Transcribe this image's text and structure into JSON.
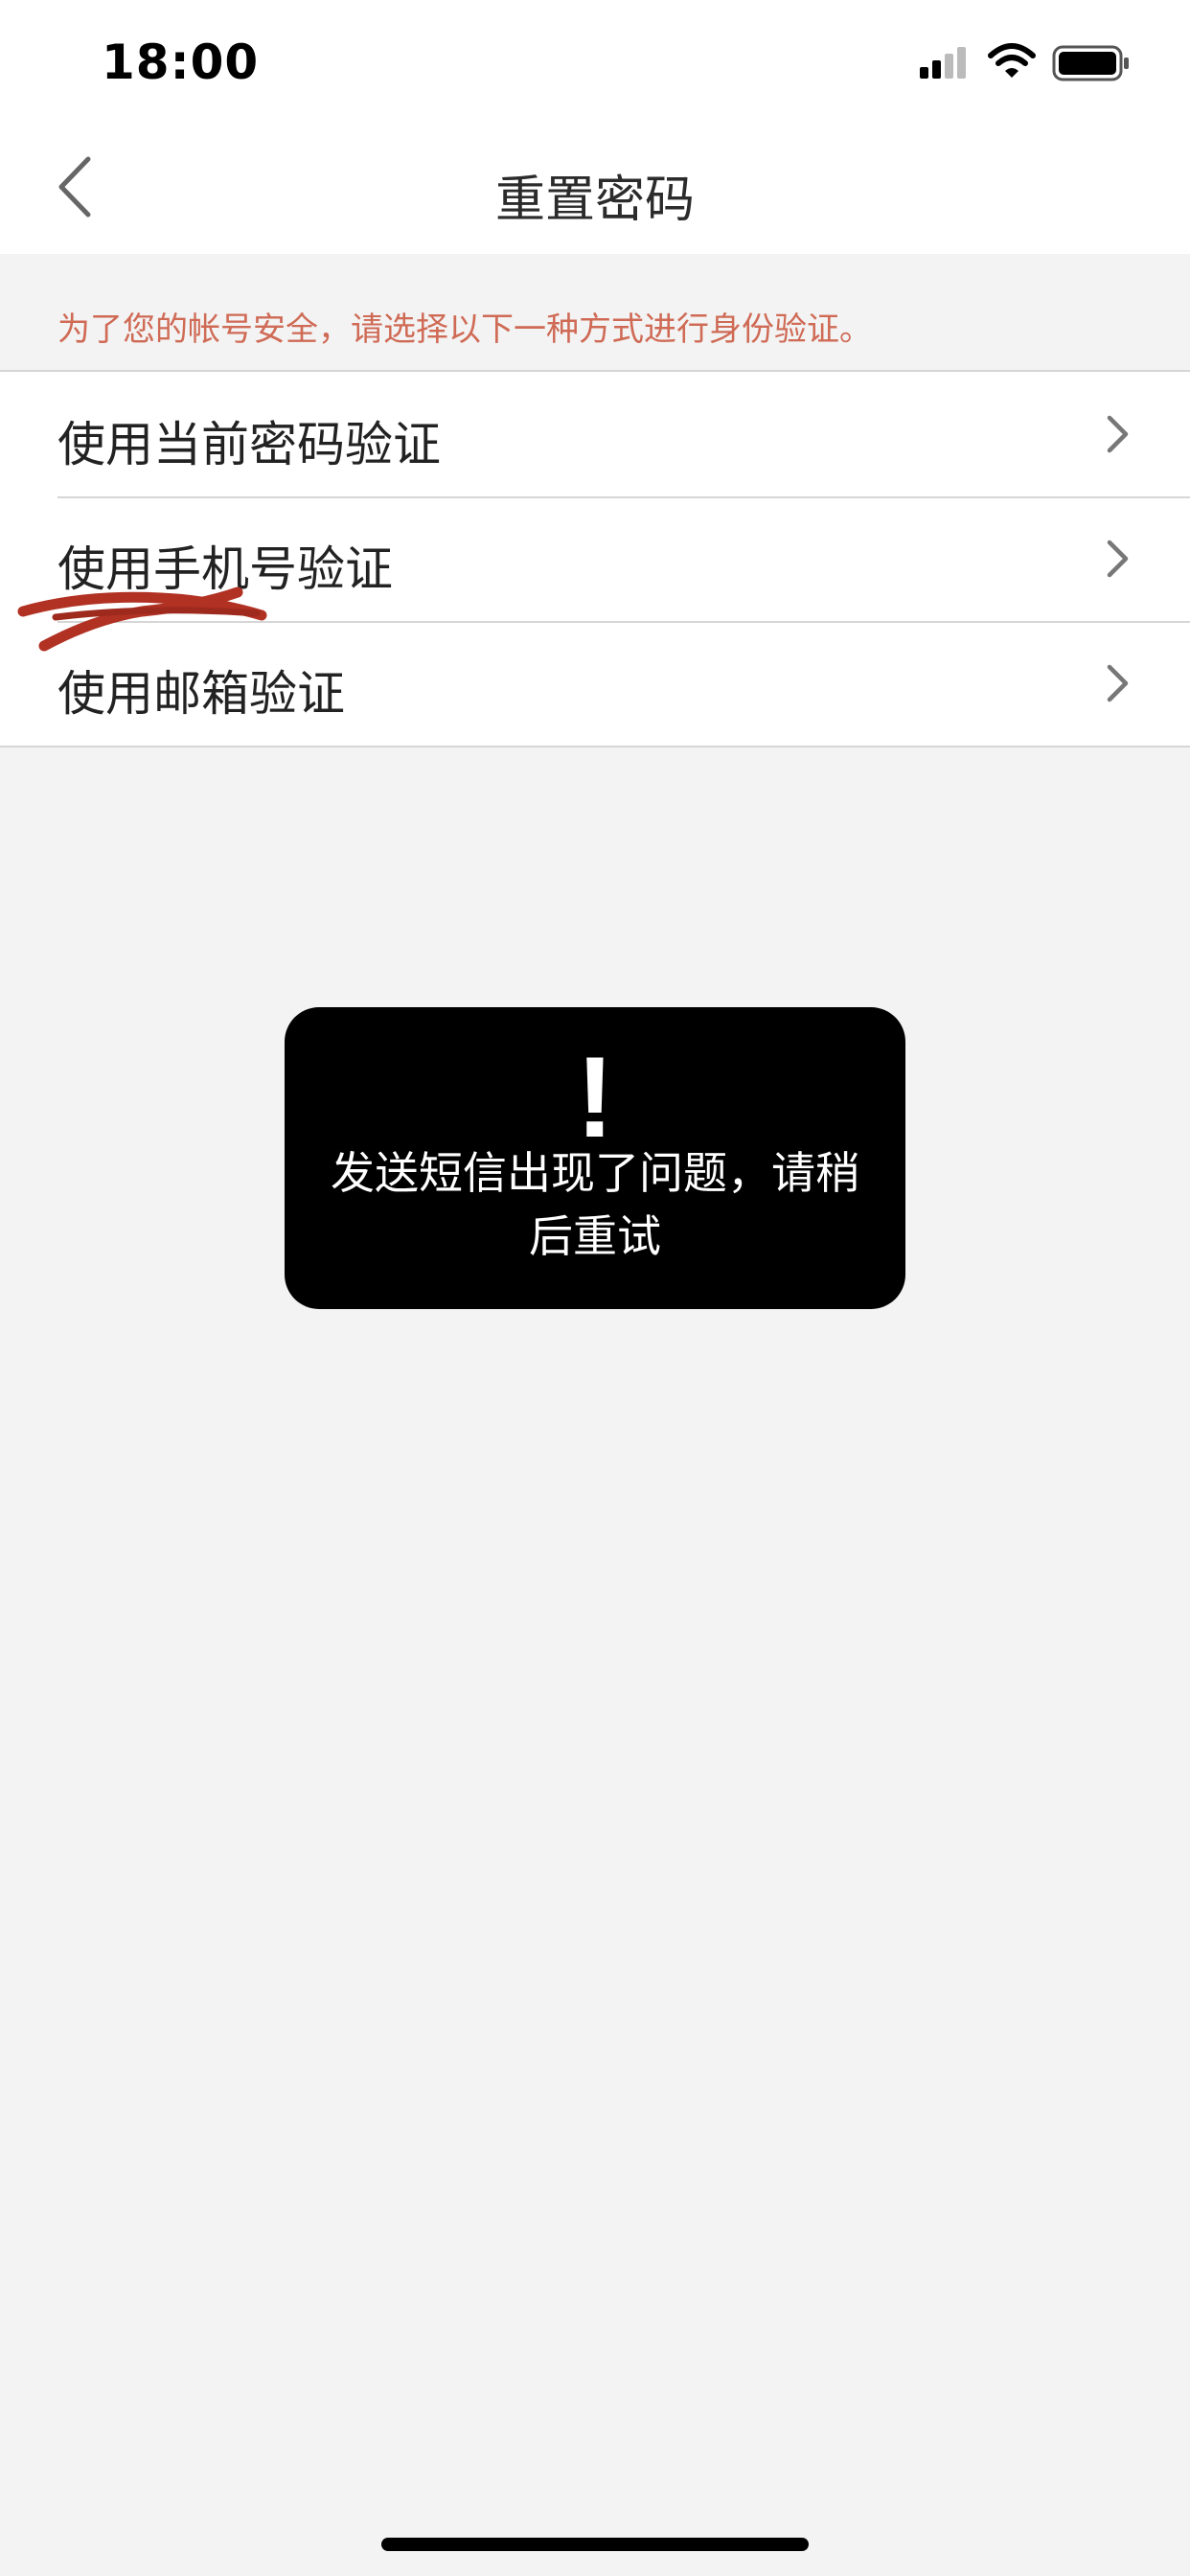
{
  "status_bar": {
    "time": "18:00",
    "icons": [
      "signal-icon",
      "wifi-icon",
      "battery-icon"
    ]
  },
  "nav": {
    "title": "重置密码",
    "back_icon": "chevron-left-icon"
  },
  "hint": "为了您的帐号安全，请选择以下一种方式进行身份验证。",
  "options": [
    {
      "label": "使用当前密码验证",
      "icon": "chevron-right-icon"
    },
    {
      "label": "使用手机号验证",
      "icon": "chevron-right-icon"
    },
    {
      "label": "使用邮箱验证",
      "icon": "chevron-right-icon"
    }
  ],
  "toast": {
    "icon": "!",
    "message": "发送短信出现了问题，请稍后重试"
  },
  "colors": {
    "hint_text": "#cf6a55",
    "background": "#f3f3f3",
    "toast_background": "#000000",
    "scribble": "#b13123"
  }
}
